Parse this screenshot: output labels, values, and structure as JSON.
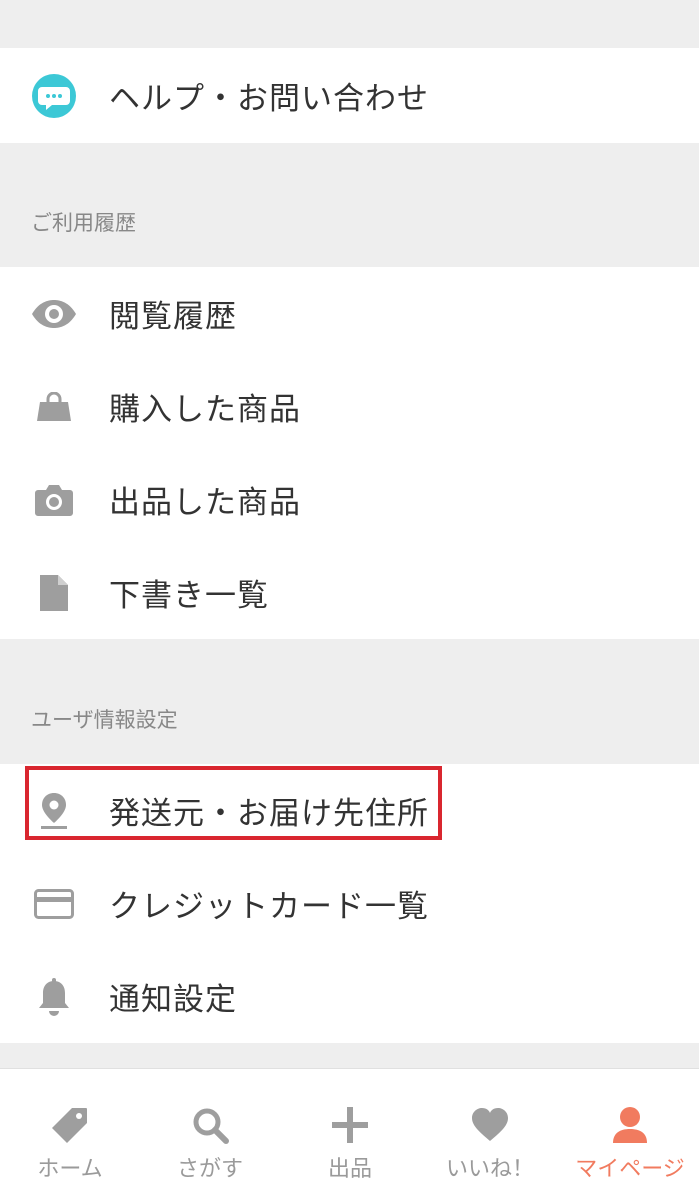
{
  "menu": {
    "help": {
      "label": "ヘルプ・お問い合わせ",
      "icon": "chat-bubble-icon"
    },
    "history_section": {
      "header": "ご利用履歴",
      "items": [
        {
          "label": "閲覧履歴",
          "icon": "eye-icon"
        },
        {
          "label": "購入した商品",
          "icon": "shopping-bag-icon"
        },
        {
          "label": "出品した商品",
          "icon": "camera-icon"
        },
        {
          "label": "下書き一覧",
          "icon": "document-icon"
        }
      ]
    },
    "user_section": {
      "header": "ユーザ情報設定",
      "items": [
        {
          "label": "発送元・お届け先住所",
          "icon": "location-pin-icon",
          "highlighted": true
        },
        {
          "label": "クレジットカード一覧",
          "icon": "credit-card-icon"
        },
        {
          "label": "通知設定",
          "icon": "bell-icon"
        }
      ]
    }
  },
  "tabbar": {
    "tabs": [
      {
        "label": "ホーム",
        "icon": "tag-icon",
        "active": false
      },
      {
        "label": "さがす",
        "icon": "search-icon",
        "active": false
      },
      {
        "label": "出品",
        "icon": "plus-icon",
        "active": false
      },
      {
        "label": "いいね！",
        "icon": "heart-icon",
        "active": false
      },
      {
        "label": "マイページ",
        "icon": "person-icon",
        "active": true
      }
    ]
  },
  "colors": {
    "accent": "#f17b5f",
    "highlight_border": "#d9262f",
    "help_icon": "#3cc8d6",
    "icon_gray": "#9e9e9e",
    "section_bg": "#eeeeee"
  }
}
